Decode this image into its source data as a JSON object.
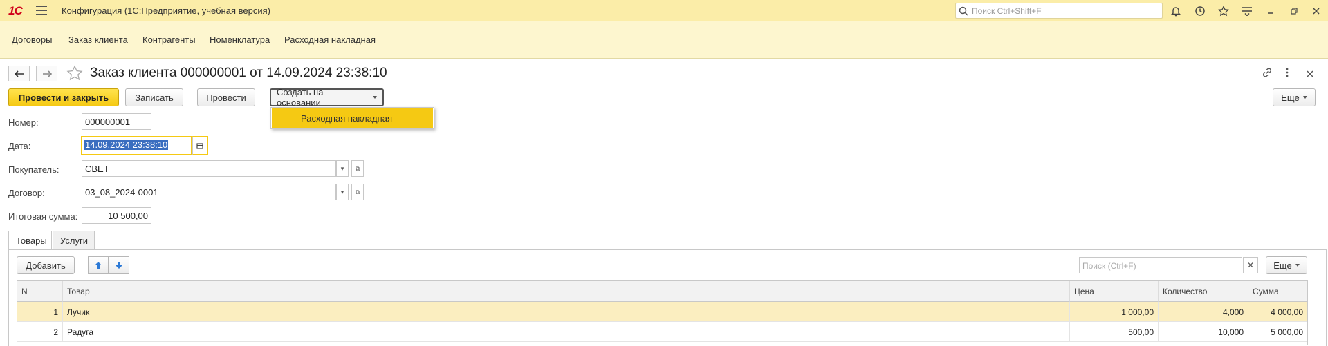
{
  "titlebar": {
    "logo": "1С",
    "app_title": "Конфигурация  (1С:Предприятие, учебная версия)",
    "search_placeholder": "Поиск Ctrl+Shift+F"
  },
  "sections": [
    "Договоры",
    "Заказ клиента",
    "Контрагенты",
    "Номенклатура",
    "Расходная накладная"
  ],
  "document": {
    "title": "Заказ клиента 000000001 от 14.09.2024 23:38:10"
  },
  "toolbar": {
    "post_close": "Провести и закрыть",
    "save": "Записать",
    "post": "Провести",
    "create_based": "Создать на основании",
    "more": "Еще"
  },
  "dropdown": {
    "item": "Расходная накладная"
  },
  "form": {
    "number_label": "Номер:",
    "number_value": "000000001",
    "date_label": "Дата:",
    "date_value": "14.09.2024 23:38:10",
    "buyer_label": "Покупатель:",
    "buyer_value": "СВЕТ",
    "contract_label": "Договор:",
    "contract_value": "03_08_2024-0001",
    "total_label": "Итоговая сумма:",
    "total_value": "10 500,00"
  },
  "tabs": [
    "Товары",
    "Услуги"
  ],
  "table_toolbar": {
    "add": "Добавить",
    "search_placeholder": "Поиск (Ctrl+F)",
    "more": "Еще"
  },
  "table": {
    "columns": [
      "N",
      "Товар",
      "Цена",
      "Количество",
      "Сумма"
    ],
    "rows": [
      {
        "n": "1",
        "item": "Лучик",
        "price": "1 000,00",
        "qty": "4,000",
        "sum": "4 000,00"
      },
      {
        "n": "2",
        "item": "Радуга",
        "price": "500,00",
        "qty": "10,000",
        "sum": "5 000,00"
      }
    ]
  },
  "colors": {
    "accent": "#f5c913",
    "titlebar_bg": "#fbeda8",
    "sections_bg": "#fdf6cf",
    "selected_row": "#fbeec0"
  }
}
